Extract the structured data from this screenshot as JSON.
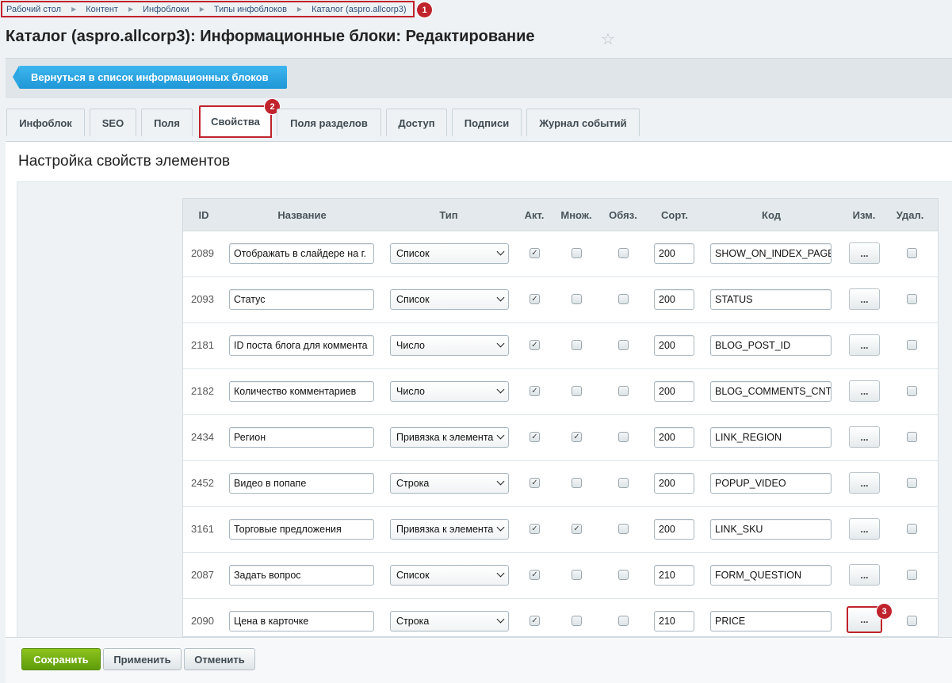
{
  "breadcrumbs": [
    "Рабочий стол",
    "Контент",
    "Инфоблоки",
    "Типы инфоблоков",
    "Каталог (aspro.allcorp3)"
  ],
  "markers": [
    "1",
    "2",
    "3"
  ],
  "page_title": "Каталог (aspro.allcorp3): Информационные блоки: Редактирование",
  "back_button": "Вернуться в список информационных блоков",
  "tabs": [
    "Инфоблок",
    "SEO",
    "Поля",
    "Свойства",
    "Поля разделов",
    "Доступ",
    "Подписи",
    "Журнал событий"
  ],
  "active_tab": "Свойства",
  "section_title": "Настройка свойств элементов",
  "columns": [
    "ID",
    "Название",
    "Тип",
    "Акт.",
    "Множ.",
    "Обяз.",
    "Сорт.",
    "Код",
    "Изм.",
    "Удал."
  ],
  "edit_label": "...",
  "check_mark": "✓",
  "rows": [
    {
      "id": "2089",
      "name": "Отображать в слайдере на г.",
      "type": "Список",
      "active": true,
      "multiple": false,
      "required": false,
      "sort": "200",
      "code": "SHOW_ON_INDEX_PAGE"
    },
    {
      "id": "2093",
      "name": "Статус",
      "type": "Список",
      "active": true,
      "multiple": false,
      "required": false,
      "sort": "200",
      "code": "STATUS"
    },
    {
      "id": "2181",
      "name": "ID поста блога для коммента",
      "type": "Число",
      "active": true,
      "multiple": false,
      "required": false,
      "sort": "200",
      "code": "BLOG_POST_ID"
    },
    {
      "id": "2182",
      "name": "Количество комментариев",
      "type": "Число",
      "active": true,
      "multiple": false,
      "required": false,
      "sort": "200",
      "code": "BLOG_COMMENTS_CNT"
    },
    {
      "id": "2434",
      "name": "Регион",
      "type": "Привязка к элемента",
      "active": true,
      "multiple": true,
      "required": false,
      "sort": "200",
      "code": "LINK_REGION"
    },
    {
      "id": "2452",
      "name": "Видео в попапе",
      "type": "Строка",
      "active": true,
      "multiple": false,
      "required": false,
      "sort": "200",
      "code": "POPUP_VIDEO"
    },
    {
      "id": "3161",
      "name": "Торговые предложения",
      "type": "Привязка к элемента",
      "active": true,
      "multiple": true,
      "required": false,
      "sort": "200",
      "code": "LINK_SKU"
    },
    {
      "id": "2087",
      "name": "Задать вопрос",
      "type": "Список",
      "active": true,
      "multiple": false,
      "required": false,
      "sort": "210",
      "code": "FORM_QUESTION"
    },
    {
      "id": "2090",
      "name": "Цена в карточке",
      "type": "Строка",
      "active": true,
      "multiple": false,
      "required": false,
      "sort": "210",
      "code": "PRICE"
    }
  ],
  "footer": {
    "save": "Сохранить",
    "apply": "Применить",
    "cancel": "Отменить"
  },
  "colors": {
    "accent_blue": "#1f96d6",
    "highlight_red": "#c0232c",
    "save_green": "#6aa812"
  }
}
